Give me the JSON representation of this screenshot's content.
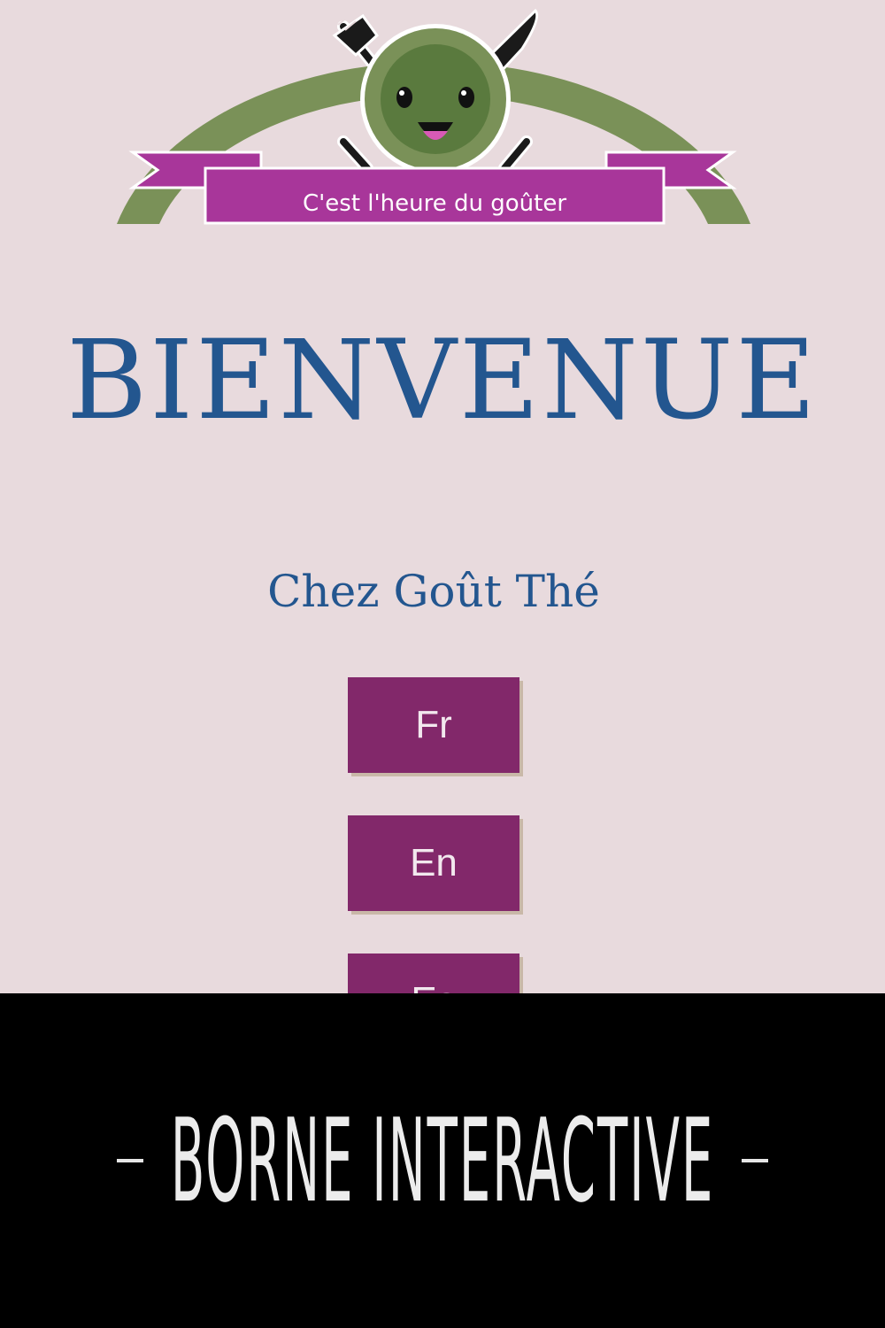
{
  "logo": {
    "tagline": "C'est l'heure du goûter",
    "colors": {
      "arch": "#7a9158",
      "ribbon": "#a8369a",
      "face": "#5a7a3e",
      "cutlery": "#1a1a1a"
    }
  },
  "welcome": {
    "title": "BIENVENUE",
    "shop_name": "Chez Goût Thé"
  },
  "languages": {
    "fr": "Fr",
    "en": "En",
    "es": "Es"
  },
  "banner": {
    "text": "BORNE INTERACTIVE"
  },
  "colors": {
    "background": "#e8dadd",
    "title": "#23568f",
    "button": "#82286a",
    "banner": "#000000"
  }
}
